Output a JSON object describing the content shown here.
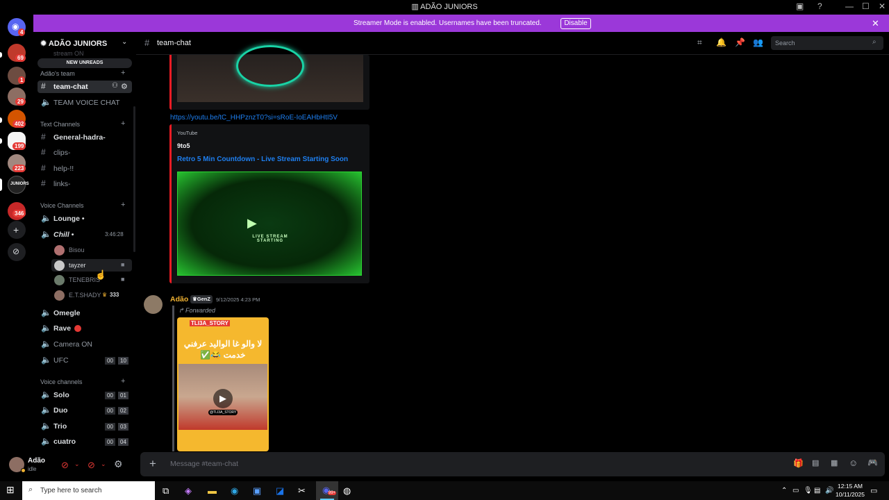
{
  "window": {
    "title": "ADÃO JUNIORS"
  },
  "banner": {
    "message": "Streamer Mode is enabled. Usernames have been truncated.",
    "disable_label": "Disable"
  },
  "rail": {
    "badges": [
      "4",
      "69",
      "1",
      "29",
      "402",
      "199",
      "223",
      "346"
    ]
  },
  "guild": {
    "name": "ADÃO JUNIORS",
    "new_unreads": "NEW UNREADS",
    "partial_top": "stream ON"
  },
  "categories": {
    "team": "Adão's team",
    "text": "Text Channels",
    "voice": "Voice Channels",
    "voice2": "Voice channels"
  },
  "channels": {
    "team_chat": "team-chat",
    "team_voice": "TEAM VOICE CHAT",
    "general": "General-hadra-",
    "clips": "clips-",
    "help": "help-!!",
    "links": "links-",
    "lounge": "Lounge •",
    "chill": "Chill •",
    "chill_timer": "3:46:28",
    "omegle": "Omegle",
    "rave": "Rave",
    "camera_on": "Camera ON",
    "ufc": "UFC",
    "ufc_counts": [
      "00",
      "10"
    ],
    "solo": "Solo",
    "solo_counts": [
      "00",
      "01"
    ],
    "duo": "Duo",
    "duo_counts": [
      "00",
      "02"
    ],
    "trio": "Trio",
    "trio_counts": [
      "00",
      "03"
    ],
    "cuatro": "cuatro",
    "cuatro_counts": [
      "00",
      "04"
    ]
  },
  "voice_users": [
    {
      "name": "Bisou"
    },
    {
      "name": "tayzer"
    },
    {
      "name": "TENEBRIS"
    },
    {
      "name": "E.T.SHADY",
      "tag": "333"
    }
  ],
  "userpanel": {
    "name": "Adão",
    "status": "idle"
  },
  "header": {
    "channel": "team-chat",
    "search_placeholder": "Search"
  },
  "messages": {
    "link": "https://youtu.be/tC_HHPznzT0?si=sRoE-IoEAHbHtI5V",
    "embed_provider": "YouTube",
    "embed_author": "9to5",
    "embed_title": "Retro 5 Min Countdown - Live  Stream Starting Soon",
    "embed_video_text": "LIVE STREAM STARTING",
    "author": "Adão",
    "author_tag": "GenZ",
    "timestamp": "9/12/2025 4:23 PM",
    "forwarded": "Forwarded",
    "story_label": "TLI3A_STORY",
    "story_text_line1": "لا والو غا الواليد عرفني",
    "story_text_line2": "خدمت 😂✅",
    "story_watermark": "@TLI3A_STORY"
  },
  "composer": {
    "placeholder": "Message #team-chat"
  },
  "taskbar": {
    "search_placeholder": "Type here to search",
    "time": "12:15 AM",
    "date": "10/11/2025",
    "discord_badge": "99+"
  },
  "colors": {
    "accent": "#9b38d9",
    "mention": "#e53935",
    "link": "#1e7ff0",
    "embed_border": "#ed1c24",
    "author": "#f0b232"
  }
}
